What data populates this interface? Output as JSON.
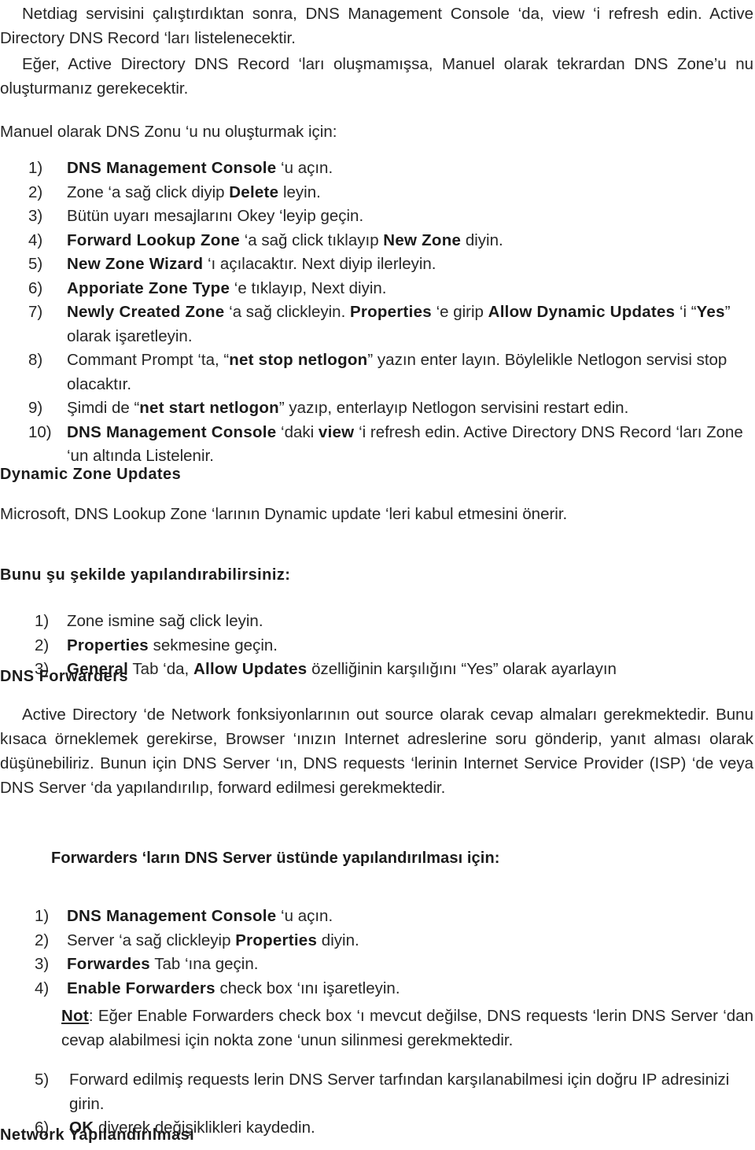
{
  "document": {
    "language": "tr",
    "text_color": "#262626",
    "background_color": "#ffffff",
    "intro_paragraph_1": "Netdiag servisini çalıştırdıktan sonra, DNS Management Console ‘da, view ‘i refresh edin. Active Directory DNS Record ‘ları listelenecektir.",
    "intro_paragraph_2": "Eğer, Active Directory DNS Record ‘ları oluşmamışsa, Manuel olarak tekrardan DNS Zone’u nu oluşturmanız gerekecektir.",
    "manual_zone_lead": "Manuel olarak DNS Zonu ‘u nu oluşturmak için:"
  },
  "manual_zone_steps": [
    {
      "num": "1)",
      "segments": [
        {
          "text": "DNS Management Console",
          "bold": true
        },
        {
          "text": " ‘u açın.",
          "bold": false
        }
      ]
    },
    {
      "num": "2)",
      "segments": [
        {
          "text": "Zone ‘a sağ click diyip ",
          "bold": false
        },
        {
          "text": "Delete",
          "bold": true
        },
        {
          "text": " leyin.",
          "bold": false
        }
      ]
    },
    {
      "num": "3)",
      "segments": [
        {
          "text": "Bütün uyarı mesajlarını Okey ‘leyip geçin.",
          "bold": false
        }
      ]
    },
    {
      "num": "4)",
      "segments": [
        {
          "text": "Forward Lookup Zone",
          "bold": true
        },
        {
          "text": " ‘a sağ click tıklayıp ",
          "bold": false
        },
        {
          "text": "New Zone",
          "bold": true
        },
        {
          "text": " diyin.",
          "bold": false
        }
      ]
    },
    {
      "num": "5)",
      "segments": [
        {
          "text": "New Zone Wizard",
          "bold": true
        },
        {
          "text": " ‘ı açılacaktır. Next diyip ilerleyin.",
          "bold": false
        }
      ]
    },
    {
      "num": "6)",
      "segments": [
        {
          "text": "Apporiate Zone Type",
          "bold": true
        },
        {
          "text": " ‘e tıklayıp, Next diyin.",
          "bold": false
        }
      ]
    },
    {
      "num": "7)",
      "segments": [
        {
          "text": "Newly Created Zone",
          "bold": true
        },
        {
          "text": " ‘a sağ clickleyin. ",
          "bold": false
        },
        {
          "text": "Properties",
          "bold": true
        },
        {
          "text": " ‘e girip ",
          "bold": false
        },
        {
          "text": "Allow Dynamic Updates",
          "bold": true
        },
        {
          "text": " ‘i “",
          "bold": false
        },
        {
          "text": "Yes",
          "bold": true
        },
        {
          "text": "” olarak işaretleyin.",
          "bold": false
        }
      ]
    },
    {
      "num": "8)",
      "segments": [
        {
          "text": "Commant Prompt ‘ta, “",
          "bold": false
        },
        {
          "text": "net stop netlogon",
          "bold": true
        },
        {
          "text": "” yazın enter layın. Böylelikle Netlogon servisi stop olacaktır.",
          "bold": false
        }
      ]
    },
    {
      "num": "9)",
      "segments": [
        {
          "text": "Şimdi de “",
          "bold": false
        },
        {
          "text": "net start netlogon",
          "bold": true
        },
        {
          "text": "” yazıp, enterlayıp Netlogon servisini restart edin.",
          "bold": false
        }
      ]
    },
    {
      "num": "10)",
      "segments": [
        {
          "text": "DNS Management Console",
          "bold": true
        },
        {
          "text": " ‘daki ",
          "bold": false
        },
        {
          "text": "view",
          "bold": true
        },
        {
          "text": " ‘i refresh edin. Active Directory DNS Record ‘ları Zone ‘un altında Listelenir.",
          "bold": false
        }
      ]
    }
  ],
  "dynamic_zone_updates": {
    "heading": "Dynamic Zone Updates",
    "paragraph": "Microsoft, DNS Lookup Zone ‘larının Dynamic update ‘leri kabul etmesini önerir.",
    "config_lead": "Bunu şu şekilde yapılandırabilirsiniz:",
    "steps": [
      {
        "num": "1)",
        "segments": [
          {
            "text": "Zone ismine sağ click leyin.",
            "bold": false
          }
        ]
      },
      {
        "num": "2)",
        "segments": [
          {
            "text": "Properties",
            "bold": true
          },
          {
            "text": " sekmesine geçin.",
            "bold": false
          }
        ]
      },
      {
        "num": "3)",
        "segments": [
          {
            "text": "General",
            "bold": true
          },
          {
            "text": " Tab ‘da, ",
            "bold": false
          },
          {
            "text": "Allow Updates",
            "bold": true
          },
          {
            "text": " özelliğinin karşılığını “Yes” olarak ayarlayın",
            "bold": false
          }
        ]
      }
    ]
  },
  "dns_forwarders": {
    "heading": "DNS Forwarders",
    "paragraph": "Active Directory ‘de Network fonksiyonlarının out source olarak cevap almaları gerekmektedir. Bunu kısaca örneklemek gerekirse, Browser ‘ınızın Internet adreslerine soru gönderip, yanıt alması olarak düşünebiliriz. Bunun için DNS Server ‘ın, DNS requests ‘lerinin Internet Service Provider (ISP) ‘de veya DNS Server ‘da yapılandırılıp, forward edilmesi gerekmektedir.",
    "subheading": "Forwarders ‘ların DNS Server üstünde yapılandırılması için:",
    "steps": [
      {
        "num": "1)",
        "segments": [
          {
            "text": "DNS Management Console",
            "bold": true
          },
          {
            "text": " ‘u açın.",
            "bold": false
          }
        ]
      },
      {
        "num": "2)",
        "segments": [
          {
            "text": "Server ‘a sağ clickleyip ",
            "bold": false
          },
          {
            "text": "Properties",
            "bold": true
          },
          {
            "text": " diyin.",
            "bold": false
          }
        ]
      },
      {
        "num": "3)",
        "segments": [
          {
            "text": "Forwardes",
            "bold": true
          },
          {
            "text": " Tab ‘ına geçin.",
            "bold": false
          }
        ]
      },
      {
        "num": "4)",
        "segments": [
          {
            "text": "Enable Forwarders",
            "bold": true
          },
          {
            "text": " check box ‘ını işaretleyin.",
            "bold": false
          }
        ]
      }
    ],
    "note": {
      "label": "Not",
      "text": ": Eğer Enable Forwarders check box ‘ı mevcut değilse, DNS requests ‘lerin DNS Server ‘dan cevap alabilmesi için nokta zone ‘unun silinmesi gerekmektedir."
    },
    "steps_continued": [
      {
        "num": "5)",
        "segments": [
          {
            "text": "Forward edilmiş requests lerin DNS Server tarfından karşılanabilmesi için doğru IP adresinizi girin.",
            "bold": false
          }
        ]
      },
      {
        "num": "6)",
        "segments": [
          {
            "text": "OK",
            "bold": true
          },
          {
            "text": " diyerek değişiklikleri kaydedin.",
            "bold": false
          }
        ]
      }
    ]
  },
  "network_section": {
    "heading": "Network Yapılandırılması"
  }
}
